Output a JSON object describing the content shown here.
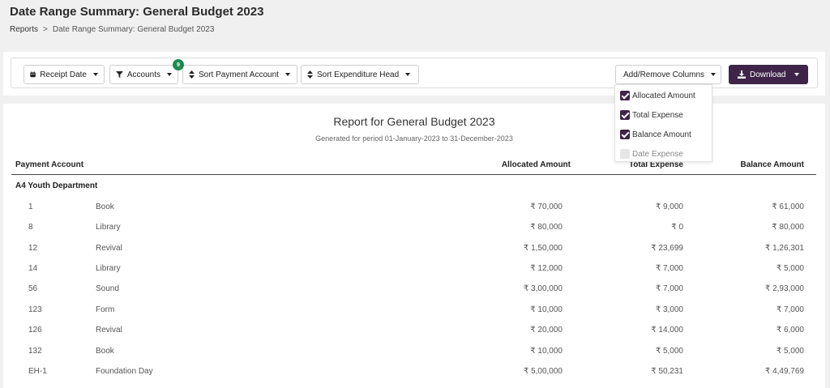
{
  "page": {
    "title": "Date Range Summary: General Budget 2023",
    "breadcrumb": {
      "root": "Reports",
      "separator": ">",
      "current": "Date Range Summary: General Budget 2023"
    }
  },
  "toolbar": {
    "receipt_date": "Receipt Date",
    "accounts": "Accounts",
    "accounts_badge": "9",
    "sort_payment_account": "Sort Payment Account",
    "sort_expenditure_head": "Sort Expenditure Head",
    "add_remove_columns": "Add/Remove Columns",
    "download": "Download"
  },
  "columns_menu": {
    "items": [
      {
        "label": "Allocated Amount",
        "checked": true
      },
      {
        "label": "Total Expense",
        "checked": true
      },
      {
        "label": "Balance Amount",
        "checked": true
      },
      {
        "label": "Date Expense",
        "checked": false
      }
    ]
  },
  "report": {
    "title": "Report for General Budget 2023",
    "subtitle": "Generated for period 01-January-2023 to 31-December-2023",
    "headers": {
      "payment_account": "Payment Account",
      "allocated": "Allocated Amount",
      "total_expense": "Total Expense",
      "balance": "Balance Amount"
    },
    "group": "A4  Youth Department",
    "rows": [
      {
        "code": "1",
        "head": "Book",
        "allocated": "₹ 70,000",
        "expense": "₹ 9,000",
        "balance": "₹ 61,000"
      },
      {
        "code": "8",
        "head": "Library",
        "allocated": "₹ 80,000",
        "expense": "₹ 0",
        "balance": "₹ 80,000"
      },
      {
        "code": "12",
        "head": "Revival",
        "allocated": "₹ 1,50,000",
        "expense": "₹ 23,699",
        "balance": "₹ 1,26,301"
      },
      {
        "code": "14",
        "head": "Library",
        "allocated": "₹ 12,000",
        "expense": "₹ 7,000",
        "balance": "₹ 5,000"
      },
      {
        "code": "56",
        "head": "Sound",
        "allocated": "₹ 3,00,000",
        "expense": "₹ 7,000",
        "balance": "₹ 2,93,000"
      },
      {
        "code": "123",
        "head": "Form",
        "allocated": "₹ 10,000",
        "expense": "₹ 3,000",
        "balance": "₹ 7,000"
      },
      {
        "code": "126",
        "head": "Revival",
        "allocated": "₹ 20,000",
        "expense": "₹ 14,000",
        "balance": "₹ 6,000"
      },
      {
        "code": "132",
        "head": "Book",
        "allocated": "₹ 10,000",
        "expense": "₹ 5,000",
        "balance": "₹ 5,000"
      },
      {
        "code": "EH-1",
        "head": "Foundation Day",
        "allocated": "₹ 5,00,000",
        "expense": "₹ 50,231",
        "balance": "₹ 4,49,769"
      }
    ]
  },
  "icons": {
    "calendar": "calendar-icon",
    "filter": "filter-icon",
    "sort": "sort-icon",
    "download": "download-icon"
  },
  "colors": {
    "primary": "#3e2448",
    "badge": "#1e8a52"
  }
}
